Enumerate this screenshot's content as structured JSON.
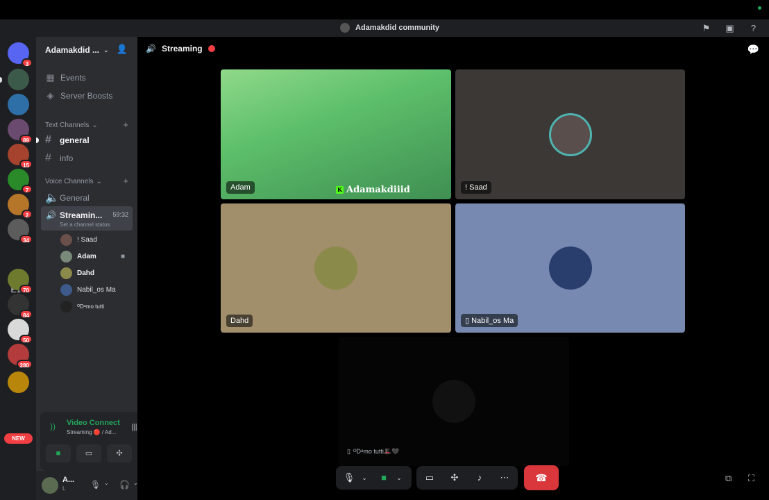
{
  "window": {
    "server_title": "Adamakdid community"
  },
  "guilds": [
    {
      "name": "discord-home",
      "badge": "3",
      "color": "#5865f2"
    },
    {
      "name": "guild-1",
      "badge": "",
      "color": "#3c5a4a"
    },
    {
      "name": "guild-2",
      "badge": "",
      "color": "#2f6fa8"
    },
    {
      "name": "guild-3",
      "badge": "89",
      "color": "#6a4a6e"
    },
    {
      "name": "guild-4",
      "badge": "15",
      "color": "#a5432e"
    },
    {
      "name": "guild-5",
      "badge": "7",
      "color": "#2a8a2a"
    },
    {
      "name": "guild-6",
      "badge": "2",
      "color": "#b5762a"
    },
    {
      "name": "guild-7",
      "badge": "34",
      "color": "#5c5c5c"
    },
    {
      "name": "guild-8",
      "badge": "70",
      "color": "#6e7a2e"
    },
    {
      "name": "guild-9",
      "badge": "84",
      "color": "#333333"
    },
    {
      "name": "guild-10",
      "badge": "50",
      "color": "#d9d9d9"
    },
    {
      "name": "guild-11",
      "badge": "280",
      "color": "#b33b3b"
    },
    {
      "name": "guild-12",
      "badge": "",
      "color": "#b8860b"
    }
  ],
  "rail": {
    "text_guild": "E1F",
    "new_badge": "NEW"
  },
  "sidebar": {
    "server_name": "Adamakdid ...",
    "events": "Events",
    "boosts": "Server Boosts",
    "text_category": "Text Channels",
    "text_channels": [
      "general",
      "info"
    ],
    "voice_category": "Voice Channels",
    "voice_general": "General",
    "active_channel": {
      "name": "Streamin...",
      "time": "59:32",
      "status": "Set a channel status"
    },
    "members": [
      "! Saad",
      "Adam",
      "Dahd",
      "Nabil_os Ma",
      "ᴼDᵃmo tutti"
    ]
  },
  "voice_panel": {
    "title": "Video Connect",
    "subtitle": "Streaming 🔴 / Ad..."
  },
  "user": {
    "name": "A...",
    "sub": "L"
  },
  "main": {
    "channel_title": "Streaming",
    "tiles": [
      {
        "label": "Adam",
        "watermark": "Adamakdiiid"
      },
      {
        "label": "! Saad"
      },
      {
        "label": "Dahd"
      },
      {
        "label": "Nabil_os Ma"
      }
    ],
    "bottom_name": "ᴼDᵃmo tutti🎩🖤"
  },
  "colors": {
    "accent_green": "#23a55a",
    "danger_red": "#da373c",
    "sidebar_bg": "#2b2d31"
  }
}
